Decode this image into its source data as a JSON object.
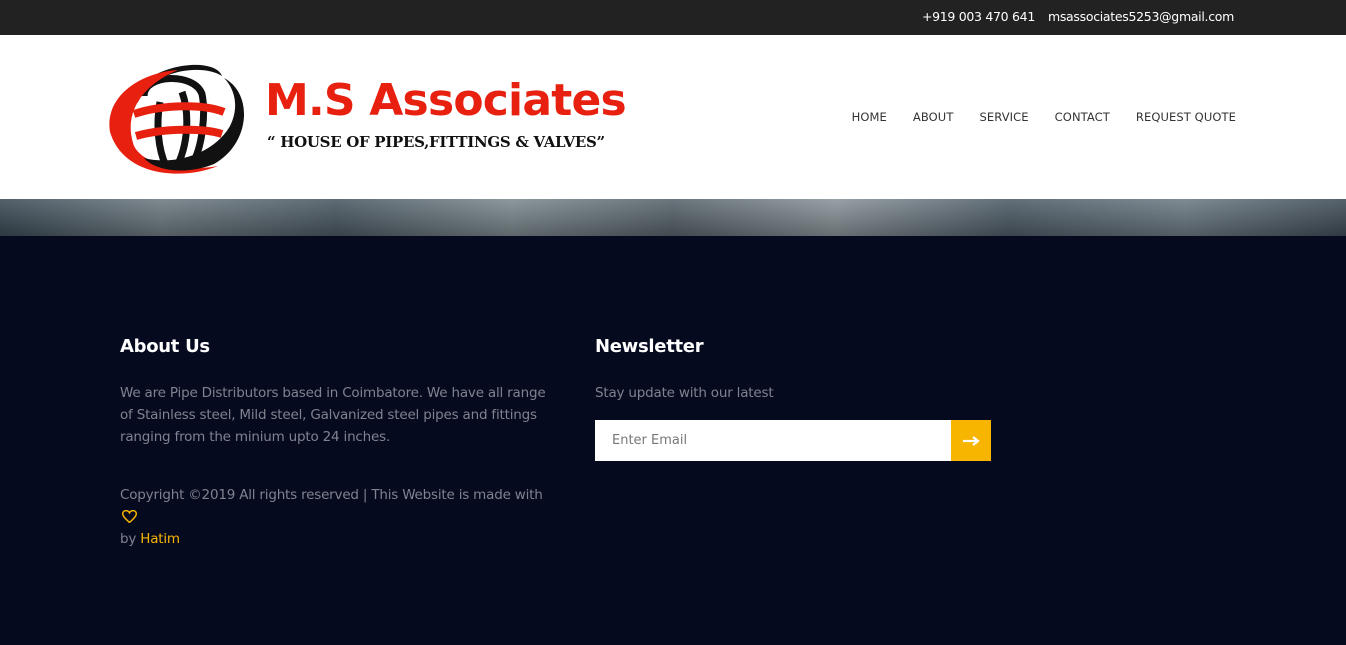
{
  "topbar": {
    "phone": "+919 003 470 641",
    "email": "msassociates5253@gmail.com"
  },
  "brand": {
    "name": "M.S Associates",
    "tagline": "“ HOUSE OF PIPES,FITTINGS & VALVES”"
  },
  "nav": {
    "items": [
      {
        "label": "HOME"
      },
      {
        "label": "ABOUT"
      },
      {
        "label": "SERVICE"
      },
      {
        "label": "CONTACT"
      },
      {
        "label": "REQUEST QUOTE"
      }
    ]
  },
  "footer": {
    "about": {
      "title": "About Us",
      "text": "We are Pipe Distributors based in Coimbatore. We have all range of Stainless steel, Mild steel, Galvanized steel pipes and fittings ranging from the minium upto 24 inches.",
      "copyright_prefix": "Copyright ©2019 All rights reserved | This Website is made with",
      "by": "by",
      "author": "Hatim"
    },
    "newsletter": {
      "title": "Newsletter",
      "text": "Stay update with our latest",
      "placeholder": "Enter Email"
    }
  },
  "colors": {
    "brand_red": "#e8200f",
    "accent": "#f7b500",
    "footer_bg": "#050a1f"
  },
  "icons": {
    "heart": "heart-icon",
    "arrow": "arrow-right-icon",
    "logo": "globe-logo-icon"
  }
}
